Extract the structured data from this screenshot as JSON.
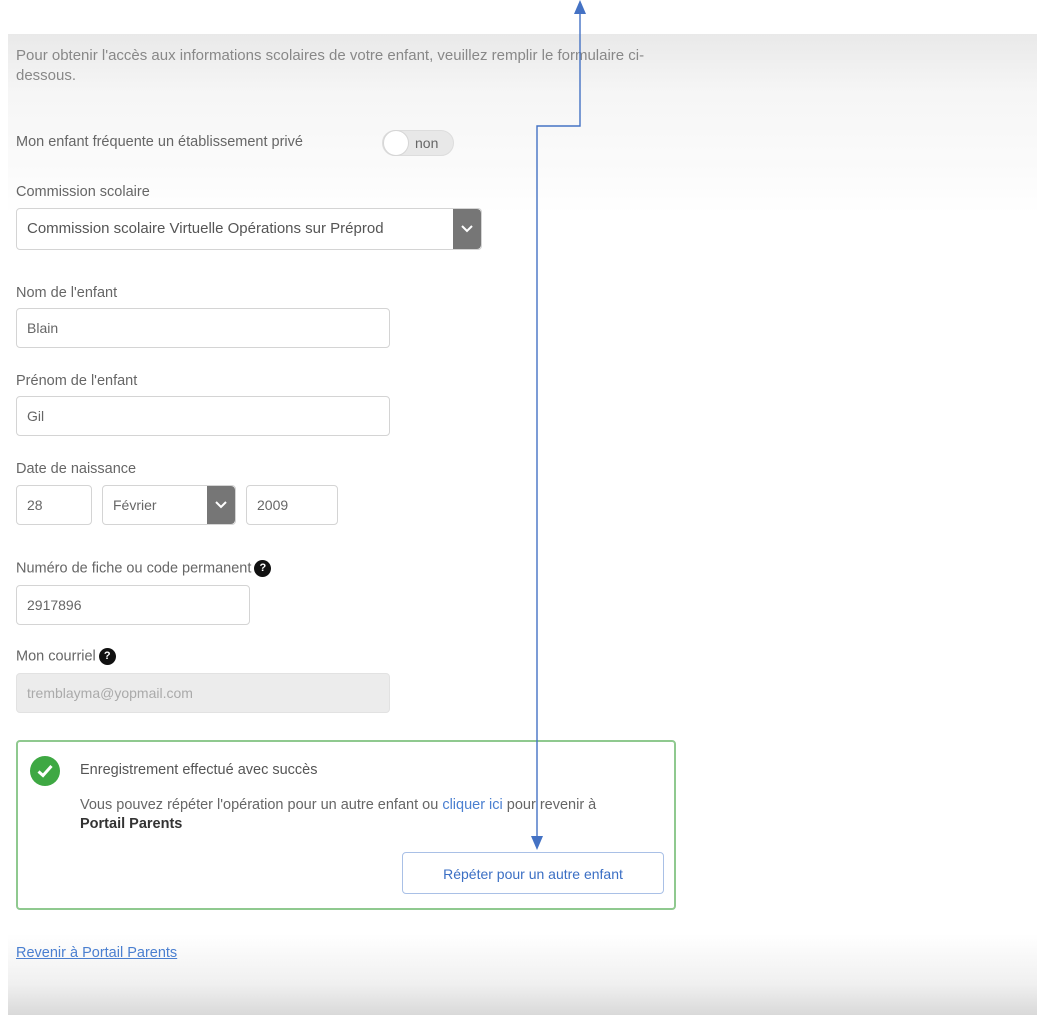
{
  "intro_text": "Pour obtenir l'accès aux informations scolaires de votre enfant, veuillez remplir le formulaire ci-dessous.",
  "private_school": {
    "label": "Mon enfant fréquente un établissement privé",
    "toggle_value": "non"
  },
  "school_board": {
    "label": "Commission scolaire",
    "value": "Commission scolaire Virtuelle Opérations sur Préprod"
  },
  "child_last_name": {
    "label": "Nom de l'enfant",
    "value": "Blain"
  },
  "child_first_name": {
    "label": "Prénom de l'enfant",
    "value": "Gil"
  },
  "birth_date": {
    "label": "Date de naissance",
    "day": "28",
    "month": "Février",
    "year": "2009"
  },
  "record_number": {
    "label": "Numéro de fiche ou code permanent",
    "value": "2917896",
    "help": "?"
  },
  "email": {
    "label": "Mon courriel",
    "value": "tremblayma@yopmail.com",
    "help": "?"
  },
  "success": {
    "title": "Enregistrement effectué avec succès",
    "text_before": "Vous pouvez répéter l'opération pour un autre enfant ou ",
    "link": "cliquer ici",
    "text_after": " pour revenir à ",
    "portal": "Portail Parents",
    "button": "Répéter pour un autre enfant"
  },
  "back_link": "Revenir à Portail Parents",
  "colors": {
    "success_border": "#8fc98f",
    "check_green": "#3ea843",
    "link_blue": "#4a7fd0",
    "annotation_blue": "#4472c4"
  },
  "icons": [
    "chevron-down-icon",
    "question-icon",
    "check-circle-icon",
    "arrow-icon"
  ]
}
